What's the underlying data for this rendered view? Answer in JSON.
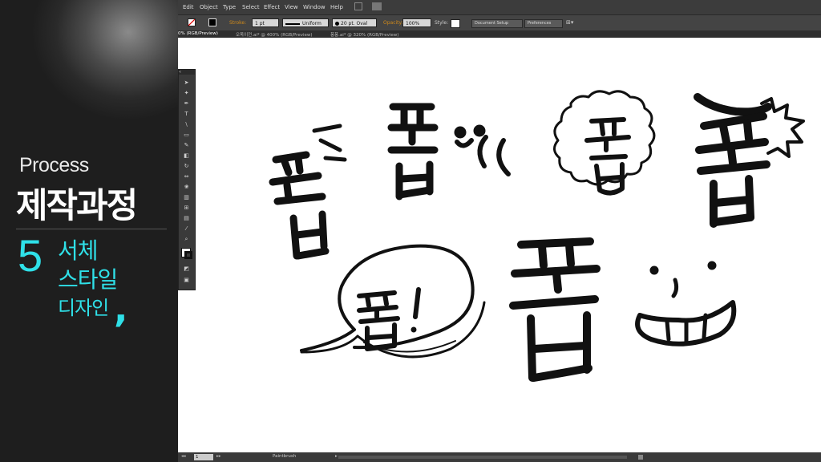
{
  "side_panel": {
    "process": "Process",
    "title": "제작과정",
    "number": "5",
    "sub_line1": "서체",
    "sub_line2": "스타일",
    "sub_line3": "디자인",
    "comma": ",",
    "accent_color": "#2fe0e8"
  },
  "menubar": {
    "items": [
      "Edit",
      "Object",
      "Type",
      "Select",
      "Effect",
      "View",
      "Window",
      "Help"
    ]
  },
  "control_bar": {
    "stroke_label": "Stroke:",
    "stroke_weight": "1 pt",
    "uniform": "Uniform",
    "brush": "20 pt. Oval",
    "opacity_label": "Opacity:",
    "opacity_value": "100%",
    "style_label": "Style:",
    "doc_setup": "Document Setup",
    "preferences": "Preferences"
  },
  "tabs": [
    "0% (RGB/Preview)",
    "오목이전.ai* @ 400% (RGB/Preview)",
    "퐁퐁.ai* @ 320% (RGB/Preview)"
  ],
  "toolbox": {
    "header": "«",
    "tools": [
      "selection-tool",
      "direct-selection-tool",
      "pen-tool",
      "type-tool",
      "rectangle-tool",
      "paintbrush-tool",
      "pencil-tool",
      "eraser-tool",
      "rotate-tool",
      "scale-tool",
      "warp-tool",
      "free-transform-tool",
      "symbol-sprayer-tool",
      "graph-tool",
      "mesh-tool",
      "gradient-tool",
      "eyedropper-tool",
      "blend-tool",
      "zoom-tool",
      "hand-tool"
    ]
  },
  "canvas_text": {
    "bubble_text": "퐁!"
  },
  "status": {
    "zoom_value": "1",
    "tool_name": "Paintbrush"
  }
}
